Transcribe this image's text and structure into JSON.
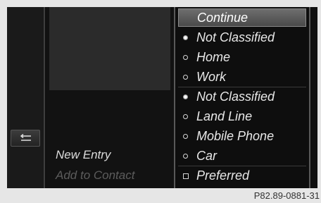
{
  "back_button": {
    "icon": "back-arrow-icon"
  },
  "middle": {
    "new_entry": "New Entry",
    "add_to_contact": "Add to Contact"
  },
  "menu": {
    "continue": "Continue",
    "items": [
      {
        "label": "Not Classified",
        "marker": "selected-dot"
      },
      {
        "label": "Home",
        "marker": "ring"
      },
      {
        "label": "Work",
        "marker": "ring"
      },
      {
        "label": "Not Classified",
        "marker": "selected-dot"
      },
      {
        "label": "Land Line",
        "marker": "ring"
      },
      {
        "label": "Mobile Phone",
        "marker": "ring"
      },
      {
        "label": "Car",
        "marker": "ring"
      },
      {
        "label": "Preferred",
        "marker": "checkbox"
      }
    ]
  },
  "footer": {
    "code": "P82.89-0881-31"
  }
}
